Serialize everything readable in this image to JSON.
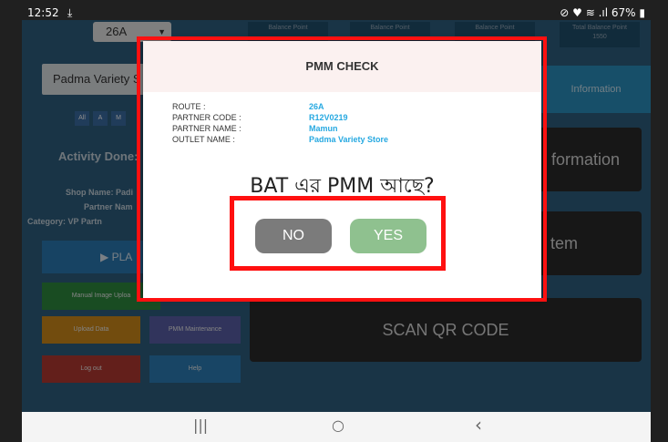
{
  "status_bar": {
    "time": "12:52",
    "download_icon": "download-icon",
    "indicators": "⊘ ♥ ≋ .ıl",
    "battery": "67%"
  },
  "app": {
    "route_select": "26A",
    "balance_points": [
      {
        "label": "Balance Point",
        "value": ""
      },
      {
        "label": "Balance Point",
        "value": ""
      },
      {
        "label": "Balance Point",
        "value": ""
      },
      {
        "label": "Total Balance Point",
        "value": "1550"
      }
    ],
    "shop_box": "Padma Variety S",
    "filters": [
      "All",
      "A",
      "M"
    ],
    "activity": "Activity Done:",
    "shop_name_label": "Shop Name: Padi",
    "partner_label": "Partner Nam",
    "category_label": "Category: VP   Partn",
    "play_button": "▶ PLA",
    "manual_image_upload": "Manual Image Uploa",
    "upload_data": "Upload Data",
    "pmm_maintenance": "PMM Maintenance",
    "logout": "Log out",
    "help": "Help",
    "information_tab": "Information",
    "cards": [
      "formation",
      "tem",
      "SCAN QR CODE"
    ]
  },
  "modal": {
    "title": "PMM CHECK",
    "info": [
      {
        "label": "ROUTE :",
        "value": "26A"
      },
      {
        "label": "PARTNER CODE :",
        "value": "R12V0219"
      },
      {
        "label": "PARTNER NAME :",
        "value": "Mamun"
      },
      {
        "label": "OUTLET NAME :",
        "value": "Padma Variety Store"
      }
    ],
    "question": "BAT এর PMM আছে?",
    "no_label": "NO",
    "yes_label": "YES"
  },
  "nav": {
    "recents": "|||",
    "home": "○",
    "back": "‹"
  },
  "colors": {
    "highlight": "#ff1010",
    "value_blue": "#27a9e1",
    "yes_green": "#8fc18f",
    "no_grey": "#7b7b7b"
  }
}
